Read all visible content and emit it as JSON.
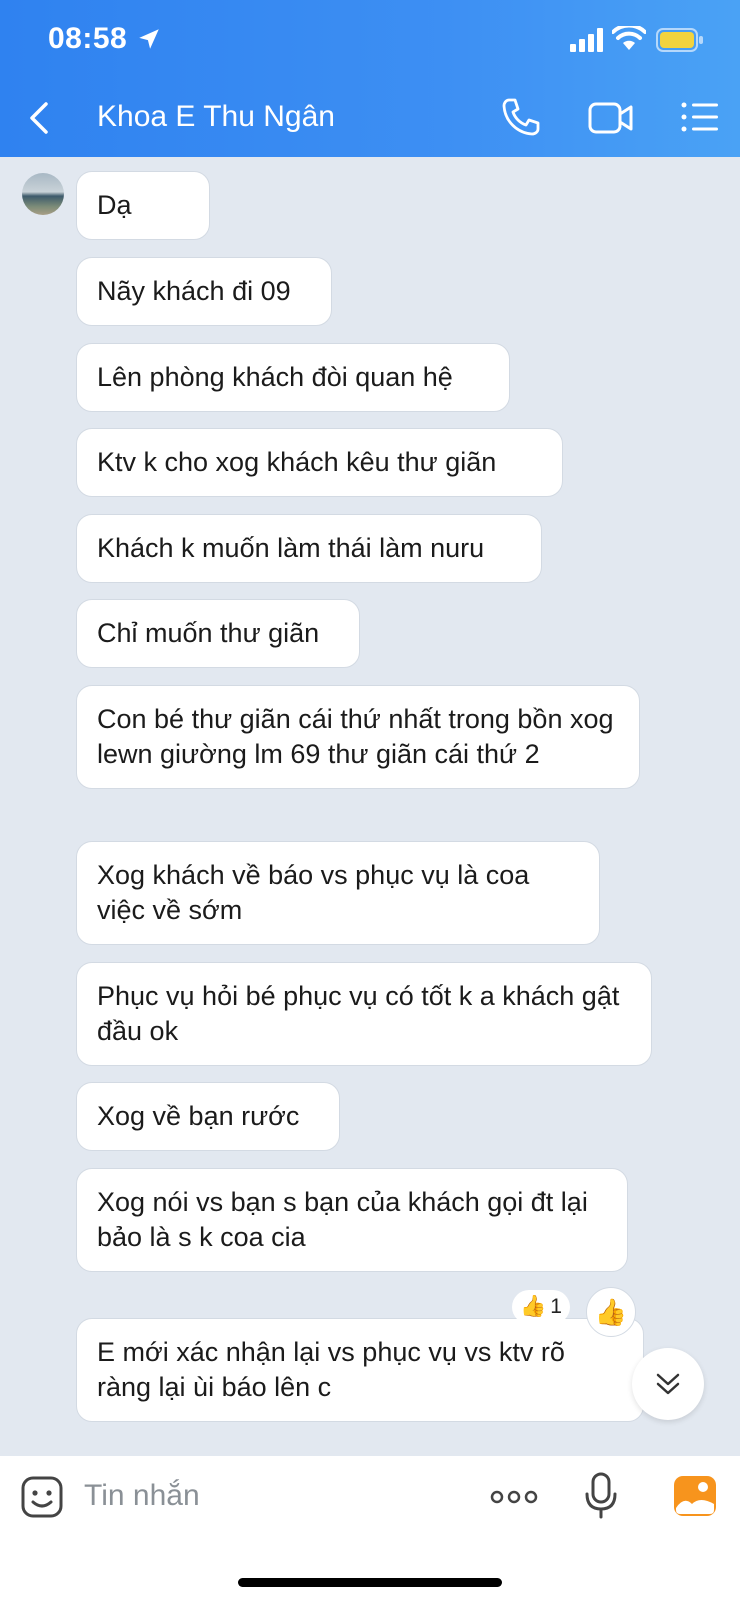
{
  "status_bar": {
    "time": "08:58"
  },
  "header": {
    "title": "Khoa E Thu Ngân"
  },
  "messages": [
    "Dạ",
    "Nãy khách đi 09",
    "Lên phòng khách đòi quan hệ",
    "Ktv k cho xog khách kêu thư giãn",
    "Khách k muốn làm thái làm nuru",
    "Chỉ muốn thư giãn",
    "Con bé thư giãn cái thứ nhất trong bồn xog lewn giường lm 69 thư giãn cái thứ 2",
    "Xog khách về báo vs phục vụ là coa việc về sớm",
    "Phục vụ hỏi bé phục vụ có tốt k a khách gật đầu ok",
    "Xog về bạn rước",
    "Xog nói vs bạn s bạn của khách gọi đt lại bảo là s k coa cia",
    "E mới xác nhận lại vs phục vụ vs ktv rõ ràng lại ùi báo lên c"
  ],
  "reaction": {
    "emoji": "👍",
    "count": "1"
  },
  "react_button": {
    "emoji": "👍"
  },
  "composer": {
    "placeholder": "Tin nhắn"
  },
  "colors": {
    "header": "#3a8cf2",
    "chat_background": "#e2e8f0",
    "bubble": "#ffffff"
  }
}
